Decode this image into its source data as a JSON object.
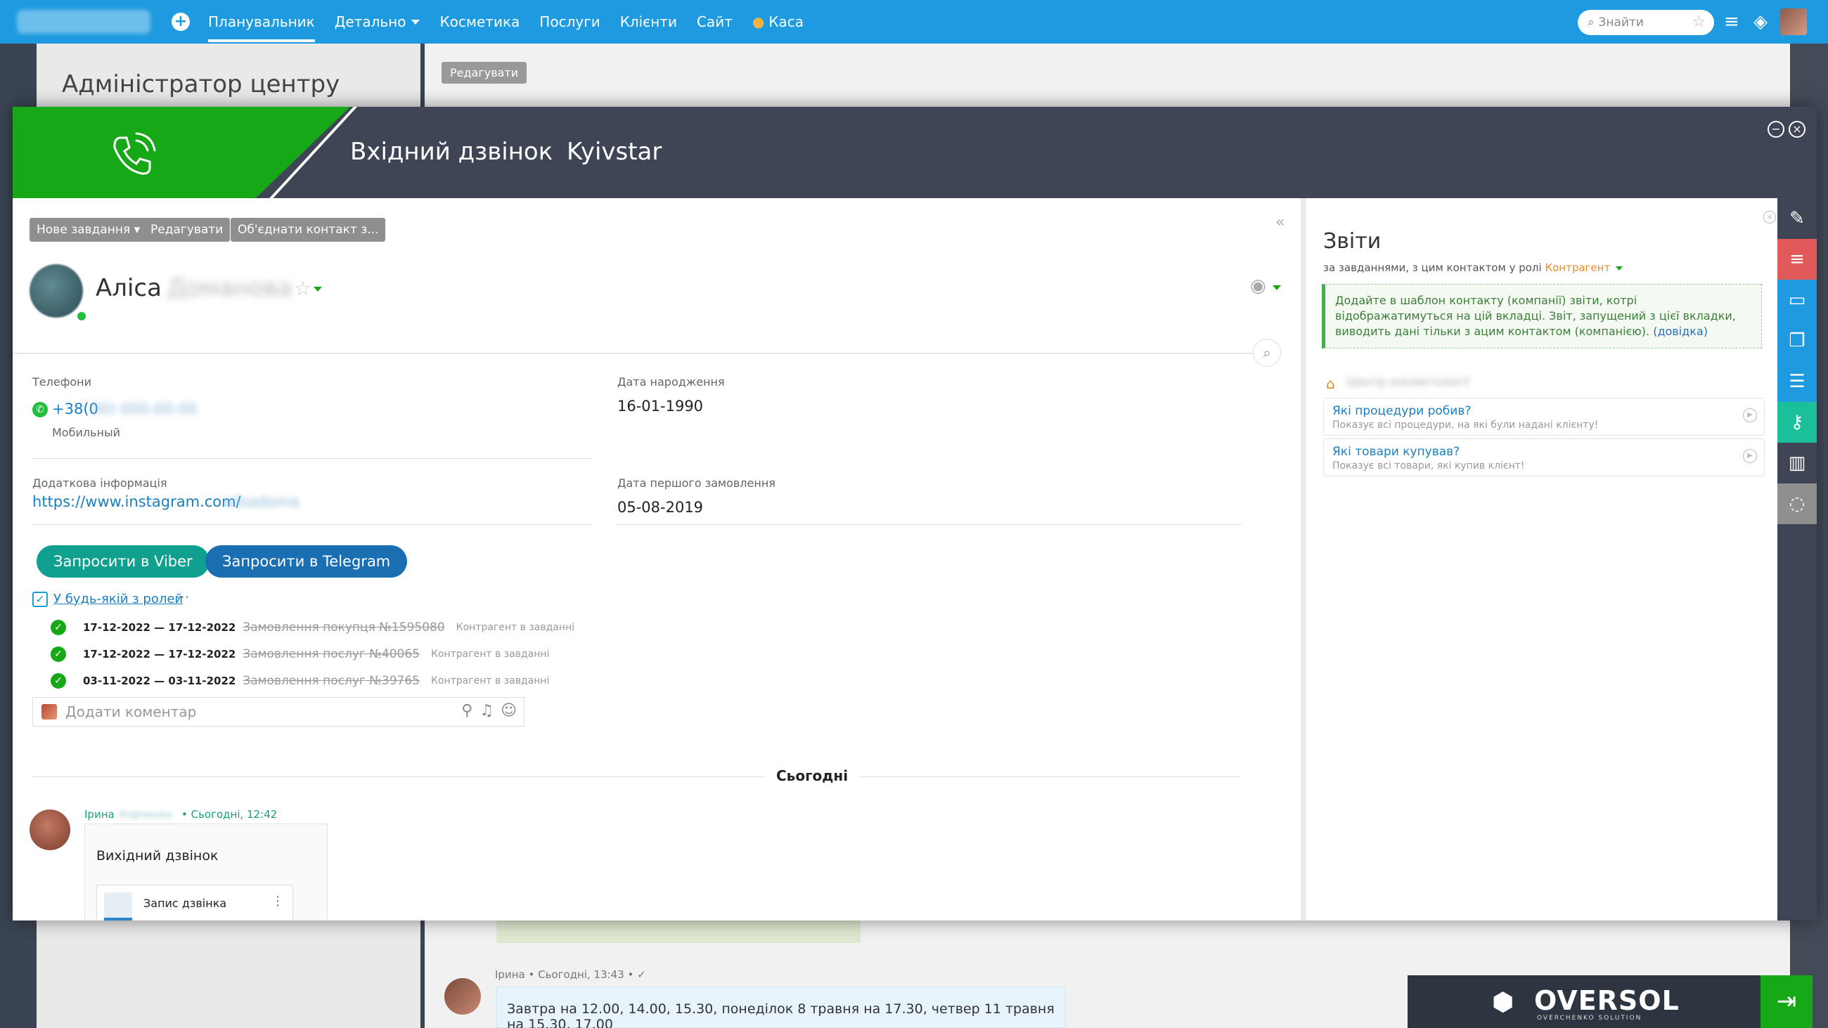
{
  "topbar": {
    "nav": [
      "Планувальник",
      "Детально",
      "Косметика",
      "Послуги",
      "Клієнти",
      "Сайт",
      "Каса"
    ],
    "search_placeholder": "Знайти"
  },
  "background": {
    "left_title": "Адміністратор центру",
    "edit_label": "Редагувати",
    "chat_name": "Ірина",
    "chat_time": "• Сьогодні, 13:43 • ✓",
    "chat_message": "Завтра на 12.00, 14.00, 15.30, понеділок 8 травня на 17.30, четвер 11 травня на 15.30, 17.00"
  },
  "call": {
    "title": "Вхідний дзвінок",
    "operator": "Kyivstar"
  },
  "toolbar": {
    "new_task": "Нове завдання",
    "edit": "Редагувати",
    "merge": "Об'єднати контакт з..."
  },
  "contact": {
    "first_name": "Аліса",
    "last_name_blurred": "Доманова",
    "fields": {
      "phones_label": "Телефони",
      "phone_prefix": "+38(0",
      "phone_hidden": "00) 000-00-00",
      "phone_type": "Мобильный",
      "birth_label": "Дата народження",
      "birth_value": "16-01-1990",
      "extra_label": "Додаткова інформація",
      "extra_value": "https://www.instagram.com/",
      "extra_hidden": "alisadoma",
      "first_order_label": "Дата першого замовлення",
      "first_order_value": "05-08-2019"
    }
  },
  "actions": {
    "viber": "Запросити в Viber",
    "telegram": "Запросити в Telegram"
  },
  "roles": {
    "label": "У будь-якій з ролей",
    "tasks": [
      {
        "dates": "17-12-2022 — 17-12-2022",
        "name": "Замовлення покупця №1595080",
        "role": "Контрагент в завданні"
      },
      {
        "dates": "17-12-2022 — 17-12-2022",
        "name": "Замовлення послуг №40065",
        "role": "Контрагент в завданні"
      },
      {
        "dates": "03-11-2022 — 03-11-2022",
        "name": "Замовлення послуг №39765",
        "role": "Контрагент в завданні"
      }
    ]
  },
  "comment": {
    "placeholder": "Додати коментар"
  },
  "feed": {
    "today": "Сьогодні",
    "author": "Ірина",
    "author_blurred": "Корченко",
    "time": "• Сьогодні, 12:42",
    "card_title": "Вихідний дзвінок",
    "record_label": "Запис дзвінка"
  },
  "reports": {
    "title": "Звіти",
    "subtitle": "за завданнями, з цим контактом у ролі",
    "role": "Контрагент",
    "note": "Додайте в шаблон контакту (компанії) звіти, котрі відображатимуться на цій вкладці. Звіт, запущений з цієї вкладки, виводить дані тільки з ацим контактом (компанією).",
    "note_link": "(довідка)",
    "group_blurred": "Центр косметології",
    "items": [
      {
        "title": "Які процедури робив?",
        "desc": "Показує всі процедури, на які були надані клієнту!"
      },
      {
        "title": "Які товари купував?",
        "desc": "Показує всі товари, які купив клієнт!"
      }
    ]
  },
  "branding": {
    "name": "OVERSOL",
    "sub": "OVERCHENKO SOLUTION"
  },
  "colors": {
    "topbar": "#1e9be0",
    "modal_header": "#3e4655",
    "call_green": "#16a816",
    "viber": "#10a08f",
    "telegram": "#1a6fb3"
  }
}
